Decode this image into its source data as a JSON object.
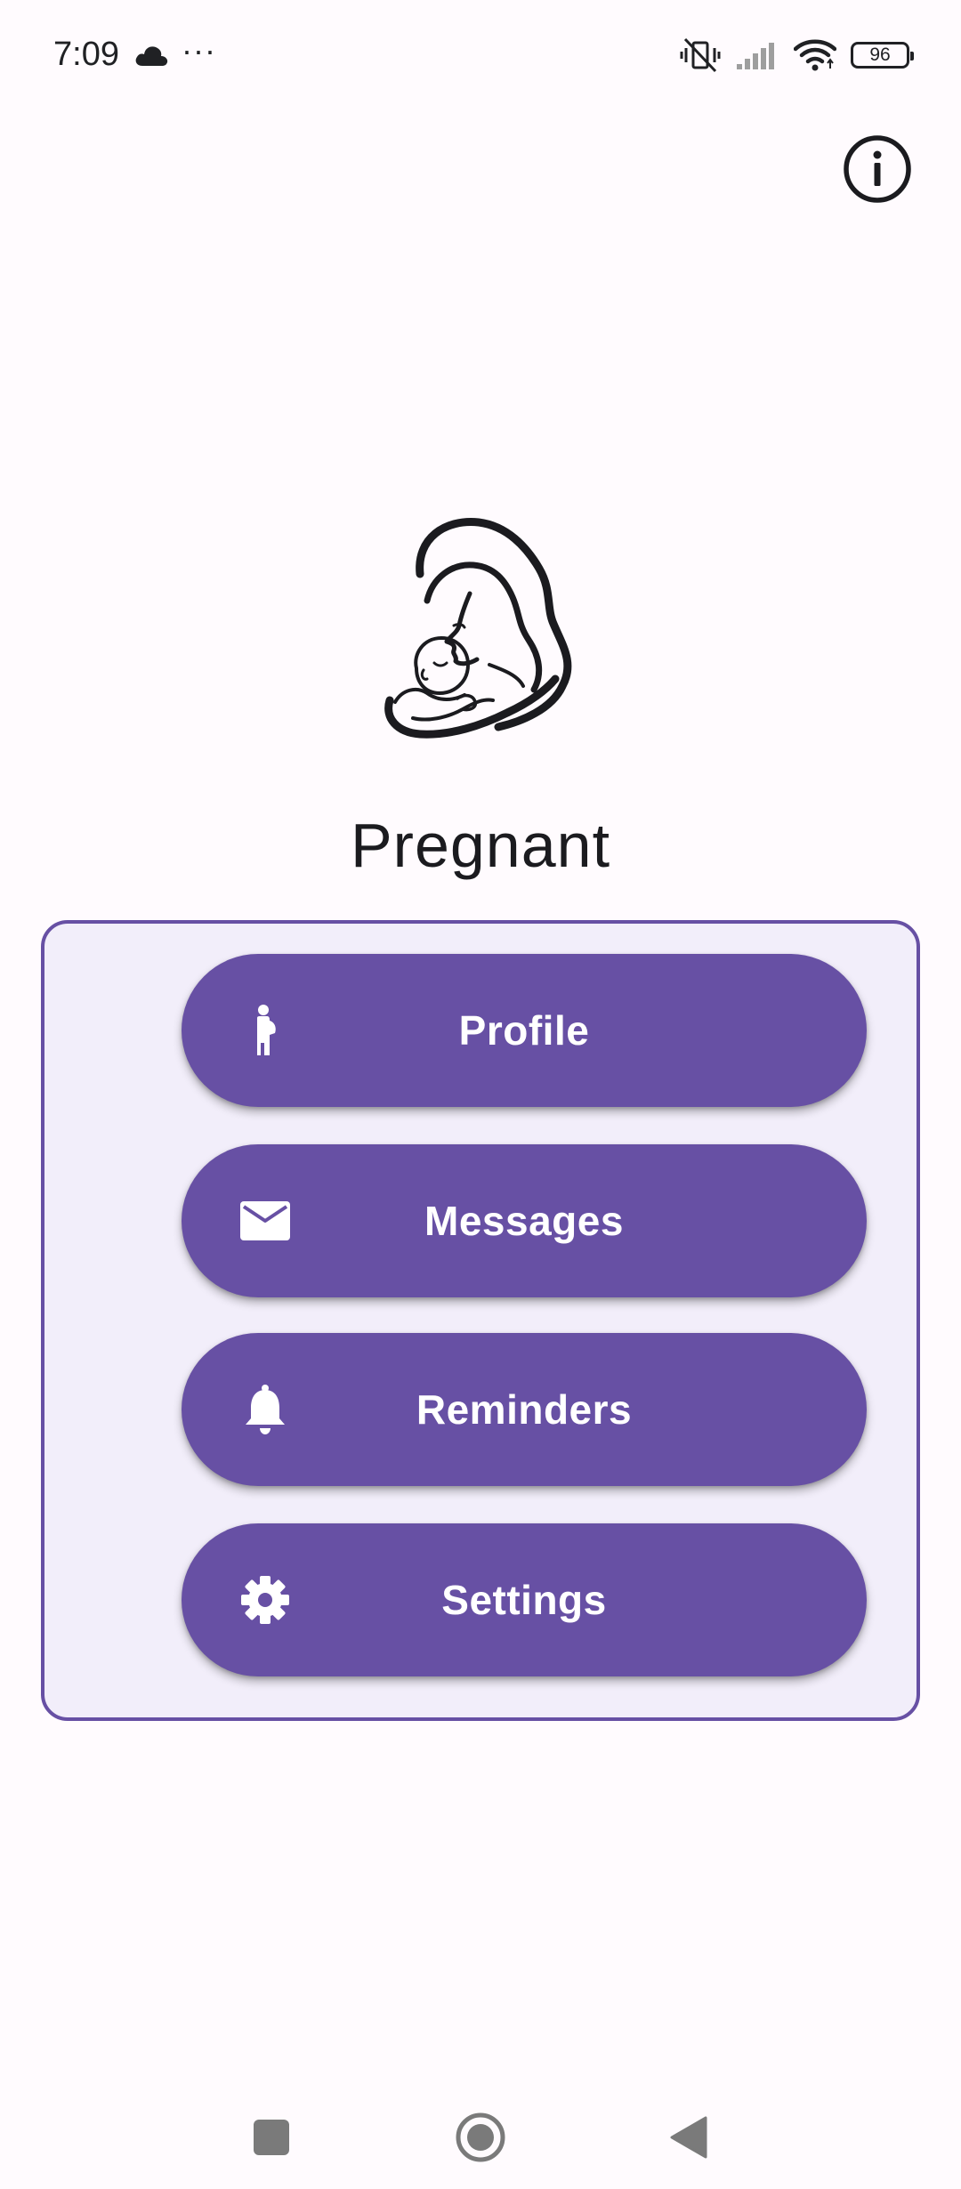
{
  "status_bar": {
    "time": "7:09",
    "more_indicator": "···",
    "battery_level": "96",
    "icons": [
      "cloud-icon",
      "vibrate-off-icon",
      "signal-icon",
      "wifi-icon",
      "battery-icon"
    ]
  },
  "header": {
    "info_icon": "info-icon"
  },
  "app": {
    "title": "Pregnant",
    "logo": "mother-baby-logo"
  },
  "menu": {
    "buttons": [
      {
        "label": "Profile",
        "icon": "pregnant-woman-icon"
      },
      {
        "label": "Messages",
        "icon": "mail-icon"
      },
      {
        "label": "Reminders",
        "icon": "bell-icon"
      },
      {
        "label": "Settings",
        "icon": "gear-icon"
      }
    ]
  },
  "nav_bar": {
    "buttons": [
      "recents-button",
      "home-button",
      "back-button"
    ]
  },
  "colors": {
    "primary": "#6750a4",
    "card_background": "#f2eefa",
    "background": "#fffbfe",
    "on_primary": "#ffffff",
    "text": "#1b1b1f"
  }
}
